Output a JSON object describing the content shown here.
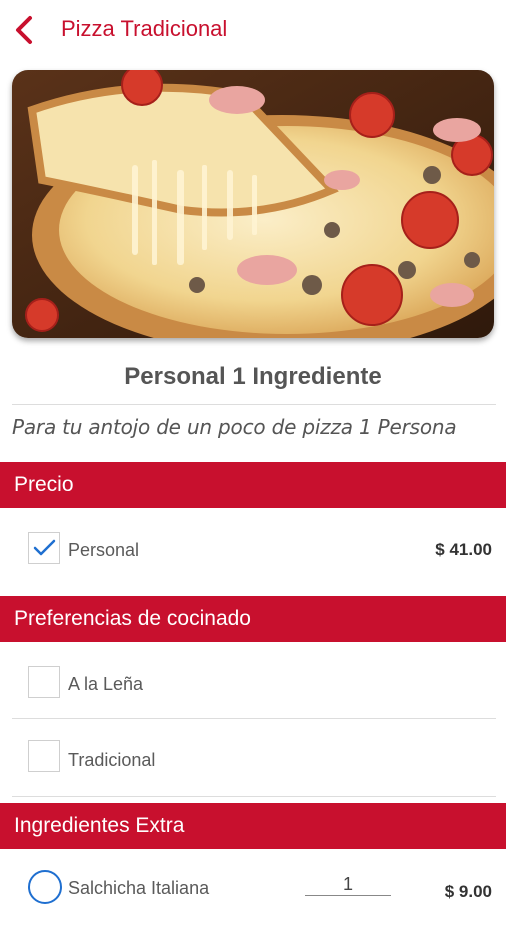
{
  "header": {
    "title": "Pizza Tradicional"
  },
  "product": {
    "name": "Personal 1 Ingrediente",
    "description": "Para tu antojo de un poco de pizza 1 Persona"
  },
  "sections": {
    "price": {
      "title": "Precio",
      "options": [
        {
          "label": "Personal",
          "price": "$ 41.00",
          "checked": true
        }
      ]
    },
    "cooking": {
      "title": "Preferencias de cocinado",
      "options": [
        {
          "label": "A la Leña",
          "checked": false
        },
        {
          "label": "Tradicional",
          "checked": false
        }
      ]
    },
    "extras": {
      "title": "Ingredientes Extra",
      "options": [
        {
          "label": "Salchicha Italiana",
          "quantity": "1",
          "price": "$ 9.00"
        }
      ]
    }
  },
  "colors": {
    "accent": "#c8102e",
    "check": "#1f6fd0",
    "text": "#555555"
  },
  "icons": {
    "back": "chevron-left-icon",
    "check": "checkmark-icon"
  }
}
